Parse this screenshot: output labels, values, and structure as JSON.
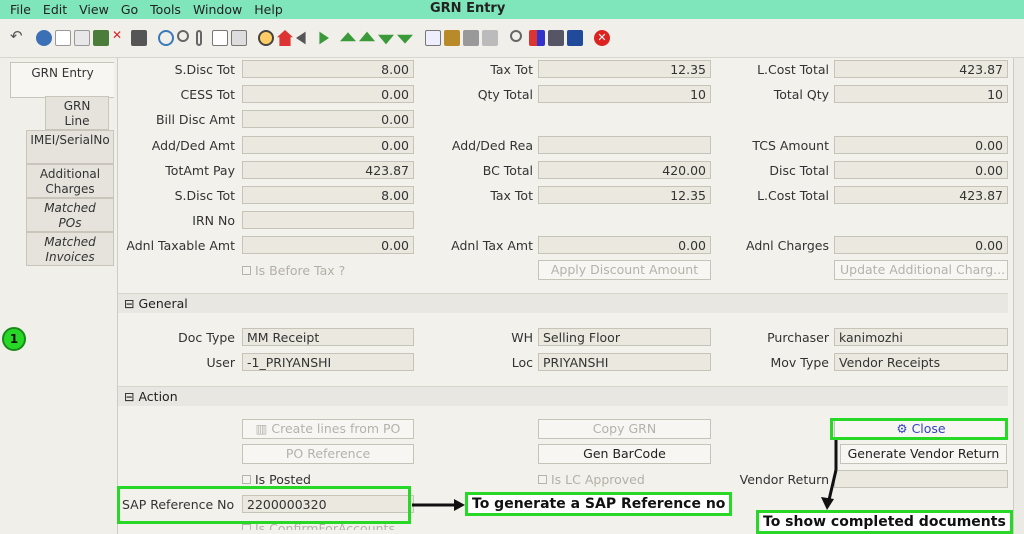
{
  "menu": {
    "items": [
      "File",
      "Edit",
      "View",
      "Go",
      "Tools",
      "Window",
      "Help"
    ],
    "title": "GRN Entry"
  },
  "toolbar_icons": [
    "undo-icon",
    "help-icon",
    "new-icon",
    "copy-icon",
    "save-icon",
    "delete-icon",
    "save-disk-icon",
    "refresh-icon",
    "find-icon",
    "attachment-icon",
    "chat-icon",
    "report-icon",
    "history-icon",
    "home-icon",
    "prev-icon",
    "next-icon",
    "first-icon",
    "up-icon",
    "down-icon",
    "last-icon",
    "detail-icon",
    "archive-icon",
    "print-icon",
    "print-preview-icon",
    "zoom-icon",
    "workflow-icon",
    "product-icon",
    "request-icon",
    "exit-icon"
  ],
  "tabs": [
    {
      "label": "GRN Entry"
    },
    {
      "label": "GRN Line"
    },
    {
      "label": "IMEI/SerialNo"
    },
    {
      "label": "Additional Charges"
    },
    {
      "label": "Matched POs"
    },
    {
      "label": "Matched Invoices"
    }
  ],
  "totals": {
    "sdisc_tot_label": "S.Disc Tot",
    "sdisc_tot": "8.00",
    "tax_tot_label": "Tax Tot",
    "tax_tot": "12.35",
    "lcost_total_label": "L.Cost Total",
    "lcost_total": "423.87",
    "cess_tot_label": "CESS Tot",
    "cess_tot": "0.00",
    "qty_total_label": "Qty Total",
    "qty_total": "10",
    "total_qty_label": "Total Qty",
    "total_qty": "10",
    "bill_disc_label": "Bill Disc Amt",
    "bill_disc": "0.00",
    "add_ded_amt_label": "Add/Ded Amt",
    "add_ded_amt": "0.00",
    "add_ded_rea_label": "Add/Ded Rea",
    "add_ded_rea": "",
    "tcs_amount_label": "TCS Amount",
    "tcs_amount": "0.00",
    "totamt_pay_label": "TotAmt Pay",
    "totamt_pay": "423.87",
    "bc_total_label": "BC Total",
    "bc_total": "420.00",
    "disc_total_label": "Disc Total",
    "disc_total": "0.00",
    "sdisc_tot2_label": "S.Disc Tot",
    "sdisc_tot2": "8.00",
    "tax_tot2_label": "Tax Tot",
    "tax_tot2": "12.35",
    "lcost_total2_label": "L.Cost Total",
    "lcost_total2": "423.87",
    "irn_label": "IRN No",
    "irn": "",
    "adnl_taxable_label": "Adnl Taxable Amt",
    "adnl_taxable": "0.00",
    "adnl_tax_label": "Adnl Tax Amt",
    "adnl_tax": "0.00",
    "adnl_charges_label": "Adnl Charges",
    "adnl_charges": "0.00",
    "is_before_tax": "Is Before Tax ?",
    "apply_discount": "Apply Discount Amount",
    "update_additional": "Update Additional Charg..."
  },
  "general": {
    "section_label": "General",
    "doc_type_label": "Doc Type",
    "doc_type": "MM Receipt",
    "wh_label": "WH",
    "wh": "Selling Floor",
    "purchaser_label": "Purchaser",
    "purchaser": "kanimozhi",
    "user_label": "User",
    "user": "-1_PRIYANSHI",
    "loc_label": "Loc",
    "loc": "PRIYANSHI",
    "mov_type_label": "Mov Type",
    "mov_type": "Vendor Receipts"
  },
  "action": {
    "section_label": "Action",
    "create_lines": "Create lines from PO",
    "copy_grn": "Copy GRN",
    "close": "Close",
    "po_reference": "PO Reference",
    "gen_barcode": "Gen BarCode",
    "generate_vendor_return": "Generate Vendor Return",
    "is_posted": "Is Posted",
    "is_lc_approved": "Is LC Approved",
    "vendor_return_label": "Vendor Return",
    "sap_ref_label": "SAP Reference No",
    "sap_ref": "2200000320",
    "is_confirm": "Is ConfirmForAccounts"
  },
  "annotations": {
    "badge": "1",
    "sap_note": "To generate a SAP Reference no",
    "close_note": "To show completed documents",
    "highlight_color": "#27d827"
  }
}
